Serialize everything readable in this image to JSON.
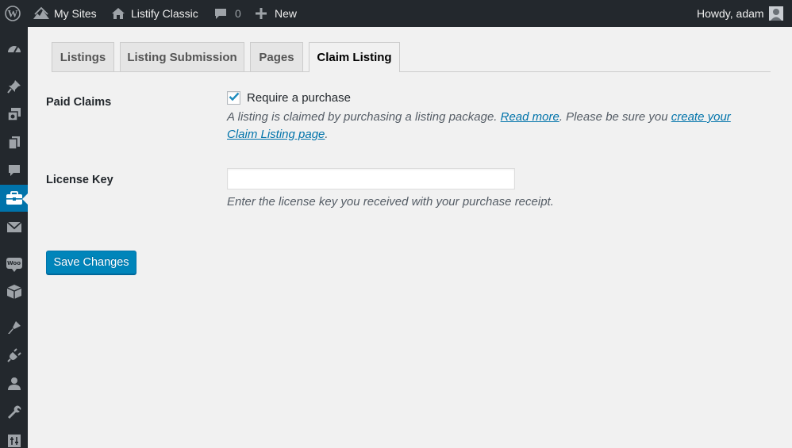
{
  "adminbar": {
    "my_sites": "My Sites",
    "site_name": "Listify Classic",
    "comments_count": "0",
    "new_label": "New",
    "howdy": "Howdy, adam"
  },
  "sidebar": {
    "icons": [
      "dashboard-icon",
      "pin-icon",
      "media-icon",
      "pages-icon",
      "comments-icon",
      "listings-briefcase-icon",
      "mail-icon",
      "woocommerce-icon",
      "products-box-icon",
      "appearance-brush-icon",
      "plugins-icon",
      "users-icon",
      "tools-wrench-icon",
      "settings-icon"
    ],
    "active": "listings-briefcase-icon"
  },
  "tabs": [
    "Listings",
    "Listing Submission",
    "Pages",
    "Claim Listing"
  ],
  "active_tab": "Claim Listing",
  "paid_claims": {
    "label": "Paid Claims",
    "checkbox_label": "Require a purchase",
    "checked": true,
    "desc_before": "A listing is claimed by purchasing a listing package. ",
    "read_more": "Read more",
    "desc_middle": ". Please be sure you ",
    "link_line1": "create your",
    "link_line2": "Claim Listing page",
    "desc_end": "."
  },
  "license_key": {
    "label": "License Key",
    "value": "",
    "description": "Enter the license key you received with your purchase receipt."
  },
  "save_button": "Save Changes",
  "colors": {
    "adminbar_bg": "#23282d",
    "accent": "#0073aa",
    "button": "#0085ba",
    "page_bg": "#f1f1f1"
  }
}
